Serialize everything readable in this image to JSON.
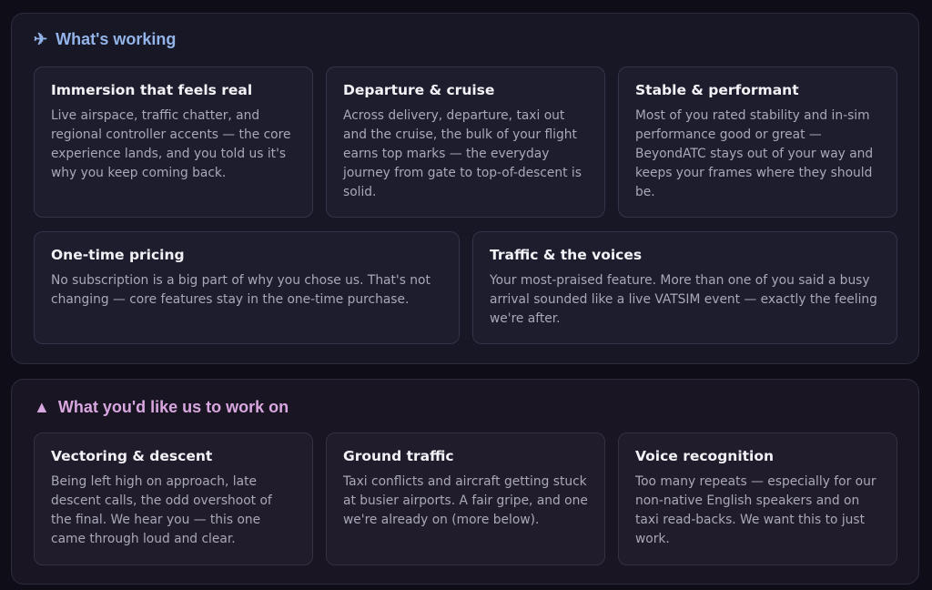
{
  "working": {
    "icon": "✈",
    "icon_name": "airplane-icon",
    "title": "What's working",
    "cards": [
      {
        "title": "Immersion that feels real",
        "body": "Live airspace, traffic chatter, and regional controller accents — the core experience lands, and you told us it's why you keep coming back."
      },
      {
        "title": "Departure & cruise",
        "body": "Across delivery, departure, taxi out and the cruise, the bulk of your flight earns top marks — the everyday journey from gate to top-of-descent is solid."
      },
      {
        "title": "Stable & performant",
        "body": "Most of you rated stability and in-sim performance good or great — BeyondATC stays out of your way and keeps your frames where they should be."
      },
      {
        "title": "One-time pricing",
        "body": "No subscription is a big part of why you chose us. That's not changing — core features stay in the one-time purchase."
      },
      {
        "title": "Traffic & the voices",
        "body": "Your most-praised feature. More than one of you said a busy arrival sounded like a live VATSIM event — exactly the feeling we're after."
      }
    ]
  },
  "work_on": {
    "icon": "▲",
    "icon_name": "triangle-up-icon",
    "title": "What you'd like us to work on",
    "cards": [
      {
        "title": "Vectoring & descent",
        "body": "Being left high on approach, late descent calls, the odd overshoot of the final. We hear you — this one came through loud and clear."
      },
      {
        "title": "Ground traffic",
        "body": "Taxi conflicts and aircraft getting stuck at busier airports. A fair gripe, and one we're already on (more below)."
      },
      {
        "title": "Voice recognition",
        "body": "Too many repeats — especially for our non-native English speakers and on taxi read-backs. We want this to just work."
      }
    ]
  },
  "colors": {
    "page_bg": "#0f0e18",
    "working_title": "#93b4e8",
    "work_on_title": "#d9a7e0",
    "card_title": "#f2f2f6",
    "card_body": "#a9a8b8"
  }
}
